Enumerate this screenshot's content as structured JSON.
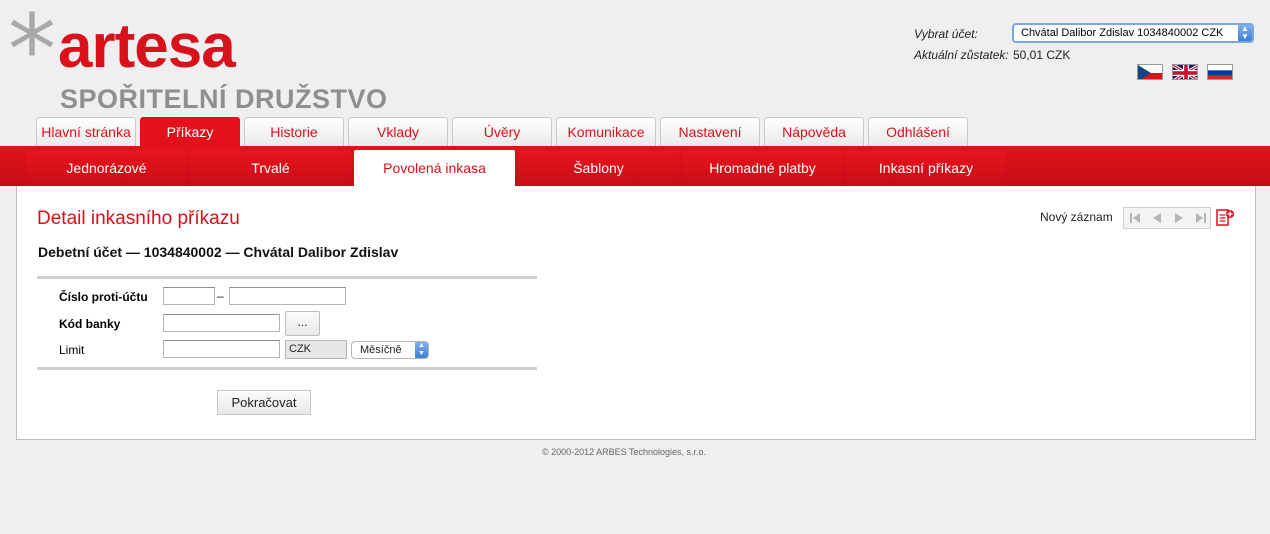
{
  "brand": {
    "asterisk": "*",
    "name": "artesa",
    "subtitle": "SPOŘITELNÍ DRUŽSTVO",
    "accent_color": "#d9111b"
  },
  "account": {
    "select_label": "Vybrat účet:",
    "selected": "Chvátal Dalibor Zdislav 1034840002 CZK",
    "balance_label": "Aktuální zůstatek:",
    "balance_value": "50,01 CZK"
  },
  "languages": [
    {
      "code": "cs",
      "icon": "czech-flag-icon"
    },
    {
      "code": "en",
      "icon": "uk-flag-icon"
    },
    {
      "code": "ru",
      "icon": "russian-flag-icon"
    }
  ],
  "main_tabs": [
    {
      "label": "Hlavní stránka",
      "active": false
    },
    {
      "label": "Příkazy",
      "active": true
    },
    {
      "label": "Historie",
      "active": false
    },
    {
      "label": "Vklady",
      "active": false
    },
    {
      "label": "Úvěry",
      "active": false
    },
    {
      "label": "Komunikace",
      "active": false
    },
    {
      "label": "Nastavení",
      "active": false
    },
    {
      "label": "Nápověda",
      "active": false
    },
    {
      "label": "Odhlášení",
      "active": false
    }
  ],
  "sub_tabs": [
    {
      "label": "Jednorázové",
      "active": false
    },
    {
      "label": "Trvalé",
      "active": false
    },
    {
      "label": "Povolená inkasa",
      "active": true
    },
    {
      "label": "Šablony",
      "active": false
    },
    {
      "label": "Hromadné platby",
      "active": false
    },
    {
      "label": "Inkasní příkazy",
      "active": false
    }
  ],
  "detail": {
    "title": "Detail inkasního příkazu",
    "debit_account": "Debetní účet — 1034840002 — Chvátal Dalibor Zdislav",
    "new_record_label": "Nový záznam",
    "nav_icons": [
      "first-record-icon",
      "previous-record-icon",
      "next-record-icon",
      "last-record-icon"
    ],
    "new_record_icon": "new-document-icon"
  },
  "form": {
    "counter_account_label": "Číslo proti-účtu",
    "counter_account_prefix": "",
    "counter_account_separator": "–",
    "counter_account_number": "",
    "bank_code_label": "Kód banky",
    "bank_code_value": "",
    "bank_lookup_button": "...",
    "limit_label": "Limit",
    "limit_value": "",
    "currency": "CZK",
    "period": "Měsíčně",
    "submit_label": "Pokračovat"
  },
  "footer": {
    "copyright": "© 2000-2012 ARBES Technologies, s.r.o."
  }
}
